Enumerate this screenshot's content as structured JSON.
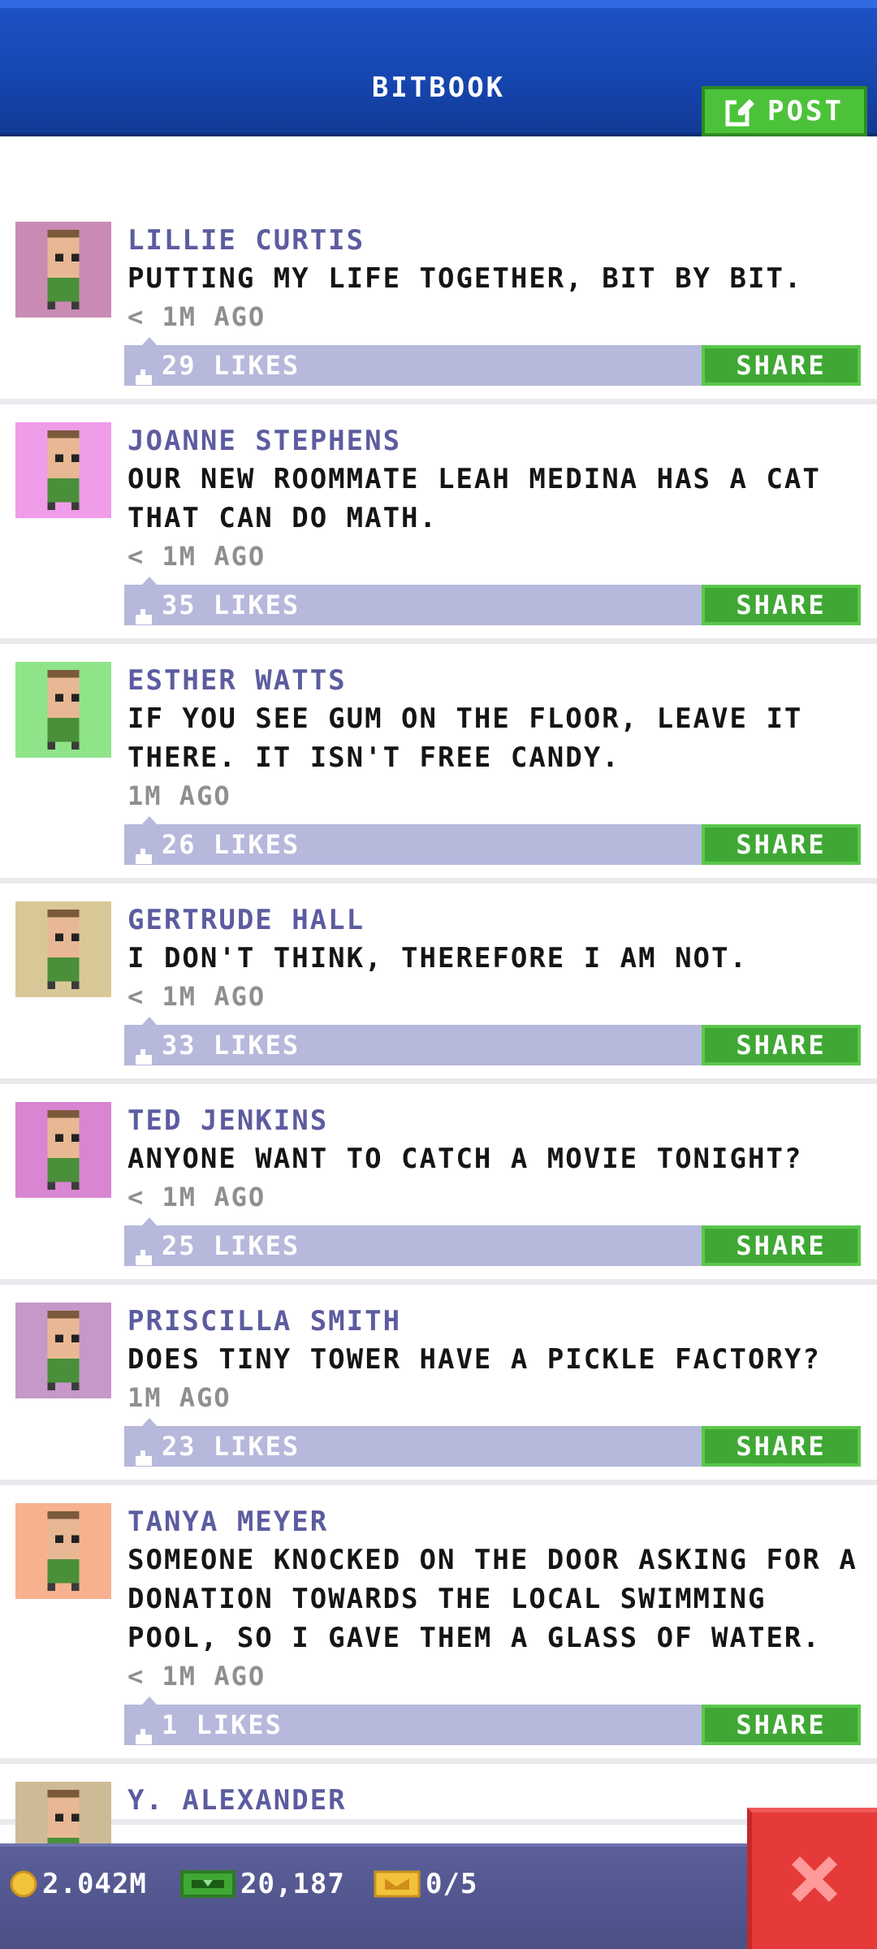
{
  "header": {
    "title": "BITBOOK",
    "post_label": "POST"
  },
  "posts": [
    {
      "author": "LILLIE CURTIS",
      "message": "PUTTING MY LIFE TOGETHER, BIT BY BIT.",
      "time": "< 1M AGO",
      "likes": "29 LIKES",
      "share_label": "SHARE",
      "avatar_bg": "#c98ab4"
    },
    {
      "author": "JOANNE STEPHENS",
      "message": "OUR NEW ROOMMATE LEAH MEDINA HAS A CAT THAT CAN DO MATH.",
      "time": "< 1M AGO",
      "likes": "35 LIKES",
      "share_label": "SHARE",
      "avatar_bg": "#ef9ce9"
    },
    {
      "author": "ESTHER WATTS",
      "message": "IF YOU SEE GUM ON THE FLOOR, LEAVE IT THERE. IT ISN'T FREE CANDY.",
      "time": "1M AGO",
      "likes": "26 LIKES",
      "share_label": "SHARE",
      "avatar_bg": "#8fe48a"
    },
    {
      "author": "GERTRUDE HALL",
      "message": "I DON'T THINK, THEREFORE I AM NOT.",
      "time": "< 1M AGO",
      "likes": "33 LIKES",
      "share_label": "SHARE",
      "avatar_bg": "#d8c897"
    },
    {
      "author": "TED JENKINS",
      "message": "ANYONE WANT TO CATCH A MOVIE TONIGHT?",
      "time": "< 1M AGO",
      "likes": "25 LIKES",
      "share_label": "SHARE",
      "avatar_bg": "#d985d2"
    },
    {
      "author": "PRISCILLA SMITH",
      "message": "DOES TINY TOWER HAVE A PICKLE FACTORY?",
      "time": "1M AGO",
      "likes": "23 LIKES",
      "share_label": "SHARE",
      "avatar_bg": "#c697c9"
    },
    {
      "author": "TANYA MEYER",
      "message": "SOMEONE KNOCKED ON THE DOOR ASKING FOR A DONATION TOWARDS THE LOCAL SWIMMING POOL, SO I GAVE THEM A GLASS OF WATER.",
      "time": "< 1M AGO",
      "likes": "1 LIKES",
      "share_label": "SHARE",
      "avatar_bg": "#f7b18f"
    },
    {
      "author": "Y. ALEXANDER",
      "message": "",
      "time": "",
      "likes": "",
      "share_label": "",
      "avatar_bg": "#cdbb95"
    }
  ],
  "bottom_bar": {
    "coins": "2.042M",
    "bux": "20,187",
    "tickets": "0/5"
  },
  "colors": {
    "header_blue": "#1646b0",
    "post_green": "#4cc23a",
    "author_purple": "#5c5ca0",
    "likes_bar": "#b6b8dc",
    "close_red": "#e63a3a"
  },
  "icons": [
    "edit-icon",
    "thumbs-up-icon",
    "coin-icon",
    "bux-icon",
    "ticket-icon",
    "close-icon"
  ]
}
